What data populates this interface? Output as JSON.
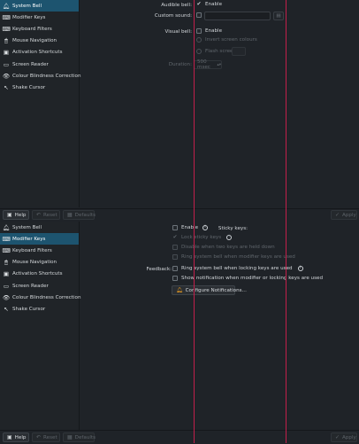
{
  "sidebar": {
    "items": [
      {
        "label": "System Bell",
        "icon": "bell-icon"
      },
      {
        "label": "Modifier Keys",
        "icon": "keyboard-icon"
      },
      {
        "label": "Keyboard Filters",
        "icon": "filter-icon"
      },
      {
        "label": "Mouse Navigation",
        "icon": "mouse-icon"
      },
      {
        "label": "Activation Shortcuts",
        "icon": "shortcut-icon"
      },
      {
        "label": "Screen Reader",
        "icon": "screen-reader-icon"
      },
      {
        "label": "Colour Blindness Correction",
        "icon": "eye-icon"
      },
      {
        "label": "Shake Cursor",
        "icon": "cursor-icon"
      }
    ]
  },
  "bell": {
    "audible_label": "Audible bell:",
    "audible_enable": "Enable",
    "custom_sound_label": "Custom sound:",
    "visual_label": "Visual bell:",
    "visual_enable": "Enable",
    "invert_screen": "Invert screen colours",
    "flash_screen": "Flash screen",
    "duration_label": "Duration:",
    "duration_value": "500 msec"
  },
  "modifier": {
    "sticky_label": "Sticky keys:",
    "sticky_enable": "Enable",
    "lock_sticky": "Lock sticky keys",
    "disable_two_keys": "Disable when two keys are held down",
    "ring_when_used": "Ring system bell when modifier keys are used",
    "feedback_label": "Feedback:",
    "ring_locking": "Ring system bell when locking keys are used",
    "show_notification": "Show notification when modifier or locking keys are used",
    "configure_button": "Configure Notifications..."
  },
  "buttons": {
    "help": "Help",
    "reset": "Reset",
    "defaults": "Defaults",
    "apply": "Apply"
  },
  "colors": {
    "accent": "#1d546f",
    "guide_line": "#c21f4b",
    "background": "#1f2328"
  }
}
